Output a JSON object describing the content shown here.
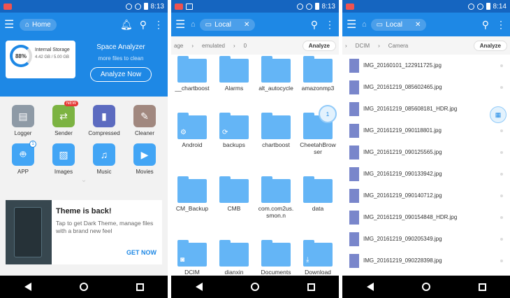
{
  "status": {
    "s1_time": "8:13",
    "s2_time": "8:13",
    "s3_time": "8:14"
  },
  "screen1": {
    "toolbar_title": "Home",
    "storage": {
      "percent": "88%",
      "label": "Internal Storage",
      "size": "4.42 GB / 5.00 GB"
    },
    "analyzer": {
      "title": "Space Analyzer",
      "subtitle": "more files to clean",
      "button": "Analyze Now"
    },
    "apps": [
      {
        "label": "Logger",
        "icon": "logger-icon",
        "color": "#8e9aa6"
      },
      {
        "label": "Sender",
        "icon": "sender-icon",
        "color": "#7cb342",
        "badge": "NEW"
      },
      {
        "label": "Compressed",
        "icon": "zip-icon",
        "color": "#5c6bc0"
      },
      {
        "label": "Cleaner",
        "icon": "broom-icon",
        "color": "#a1887f"
      },
      {
        "label": "APP",
        "icon": "android-icon",
        "color": "#42a5f5",
        "badge1": "1"
      },
      {
        "label": "Images",
        "icon": "image-icon",
        "color": "#42a5f5"
      },
      {
        "label": "Music",
        "icon": "music-icon",
        "color": "#42a5f5"
      },
      {
        "label": "Movies",
        "icon": "movie-icon",
        "color": "#42a5f5"
      }
    ],
    "theme": {
      "title": "Theme is back!",
      "body": "Tap to get Dark Theme, manage files with a brand new feel",
      "cta": "GET NOW"
    }
  },
  "screen2": {
    "tab": "Local",
    "path": [
      "age",
      "emulated",
      "0"
    ],
    "analyze": "Analyze",
    "folders": [
      "__chartboost",
      "Alarms",
      "alt_autocycle",
      "amazonmp3",
      "Android",
      "backups",
      "chartboost",
      "CheetahBrowser",
      "CM_Backup",
      "CMB",
      "com.com2us.smon.n",
      "data",
      "DCIM",
      "dianxin",
      "Documents",
      "Download"
    ],
    "bubble": "1"
  },
  "screen3": {
    "tab": "Local",
    "path": [
      "DCIM",
      "Camera"
    ],
    "analyze": "Analyze",
    "files": [
      "IMG_20160101_122911725.jpg",
      "IMG_20161219_085602465.jpg",
      "IMG_20161219_085608181_HDR.jpg",
      "IMG_20161219_090118801.jpg",
      "IMG_20161219_090125565.jpg",
      "IMG_20161219_090133942.jpg",
      "IMG_20161219_090140712.jpg",
      "IMG_20161219_090154848_HDR.jpg",
      "IMG_20161219_090205349.jpg",
      "IMG_20161219_090228398.jpg"
    ]
  }
}
